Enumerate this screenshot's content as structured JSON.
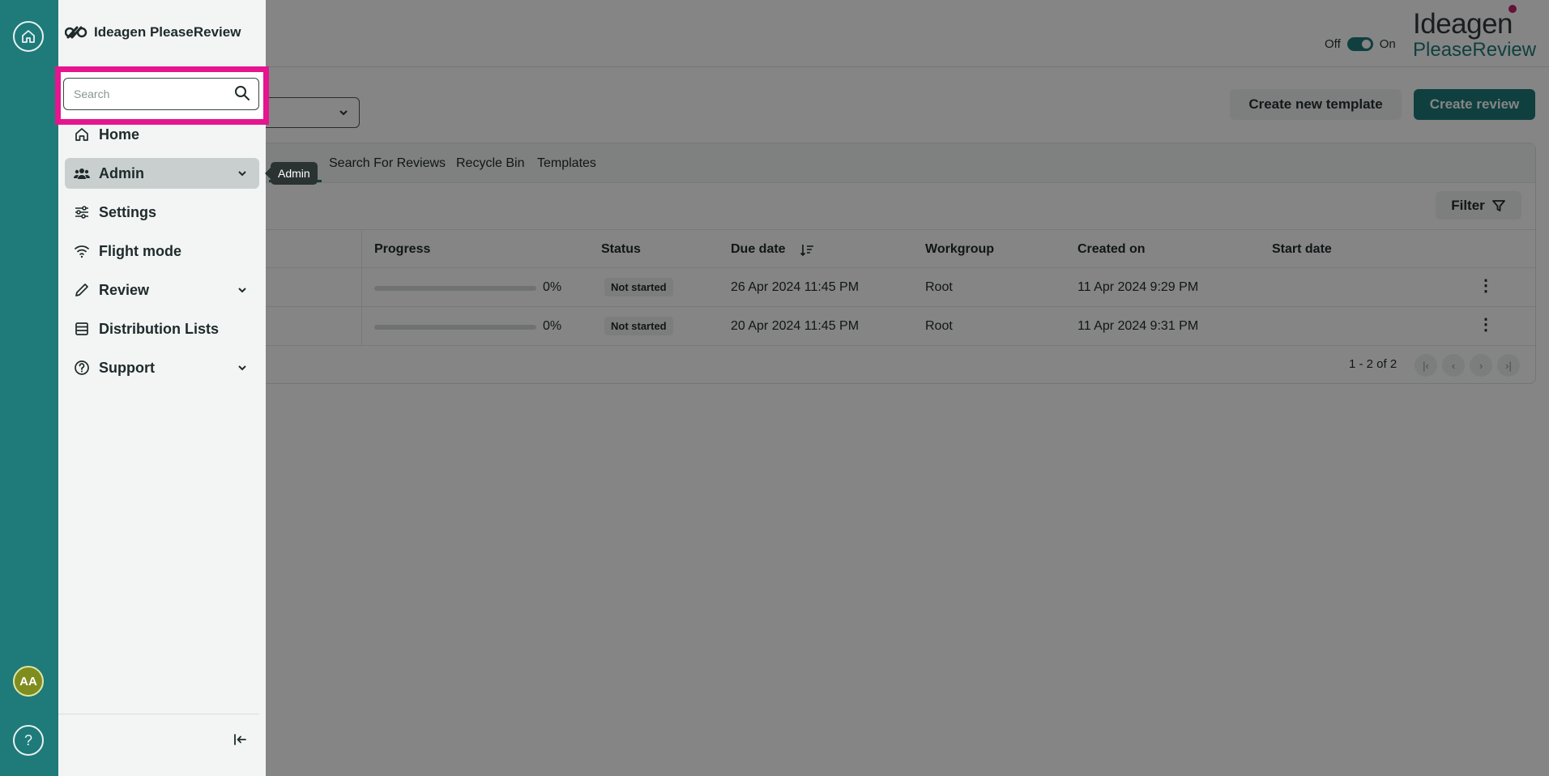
{
  "topbar": {
    "toggle_off": "Off",
    "toggle_on": "On",
    "brand_line1": "Ideagen",
    "brand_line2": "PleaseReview"
  },
  "actions": {
    "create_template": "Create new template",
    "create_review": "Create review"
  },
  "tabs": [
    "Search For Reviews",
    "Recycle Bin",
    "Templates"
  ],
  "filter_label": "Filter",
  "table": {
    "headers": {
      "progress": "Progress",
      "status": "Status",
      "due_date": "Due date",
      "workgroup": "Workgroup",
      "created_on": "Created on",
      "start_date": "Start date"
    },
    "rows": [
      {
        "progress": "0%",
        "progress_value": 0,
        "status": "Not started",
        "due_date": "26 Apr 2024 11:45 PM",
        "workgroup": "Root",
        "created_on": "11 Apr 2024 9:29 PM",
        "start_date": ""
      },
      {
        "progress": "0%",
        "progress_value": 0,
        "status": "Not started",
        "due_date": "20 Apr 2024 11:45 PM",
        "workgroup": "Root",
        "created_on": "11 Apr 2024 9:31 PM",
        "start_date": ""
      }
    ],
    "pager_text": "1 - 2 of 2"
  },
  "drawer": {
    "title": "Ideagen PleaseReview",
    "search_placeholder": "Search",
    "items": [
      {
        "label": "Home",
        "icon": "home-icon"
      },
      {
        "label": "Admin",
        "icon": "users-icon"
      },
      {
        "label": "Settings",
        "icon": "sliders-icon"
      },
      {
        "label": "Flight mode",
        "icon": "wifi-icon"
      },
      {
        "label": "Review",
        "icon": "pencil-icon"
      },
      {
        "label": "Distribution Lists",
        "icon": "list-icon"
      },
      {
        "label": "Support",
        "icon": "help-circle-icon"
      }
    ]
  },
  "tooltip": "Admin",
  "user_initials": "AA",
  "help_glyph": "?",
  "colors": {
    "brand": "#1f7a7a",
    "highlight": "#e5158f",
    "accent_logo": "#c0246e"
  }
}
